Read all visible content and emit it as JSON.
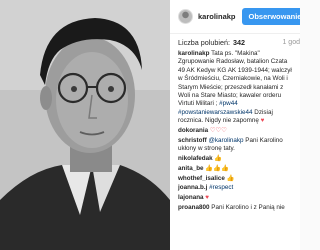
{
  "post": {
    "username": "karolinakp",
    "follow_label": "Obserwowanie",
    "likes_label": "Liczba polubień:",
    "likes_count": "342",
    "time_ago": "1 god"
  },
  "caption": {
    "username": "karolinakp",
    "text1": "Tata ps. \"Makina\" Zgrupowanie Radosław, batalion Czata 49 AK Kedyw KG AK 1939-1944; walczył w Śródmieściu, Czerniakowie, na Woli i Starym Mieście; przeszedł kanałami z Woli na Stare Miasto; kawaler orderu Virtuti Militari ; ",
    "tag1": "#pw44",
    "tag2": "#powstaniewarszawskie44",
    "text2": " Dzisiaj rocznica. Nigdy nie zapomnę ",
    "heart": "♥"
  },
  "comments": [
    {
      "user": "dokorania",
      "text": "",
      "extra": "♡♡♡"
    },
    {
      "user": "schristoff",
      "text": "",
      "mention": "@karolinakp",
      "text2": " Pani Karolino ukłony w stronę taty."
    },
    {
      "user": "nikolafedak",
      "text": "",
      "extra": "👍"
    },
    {
      "user": "anita_be",
      "text": "",
      "extra": "👍👍👍"
    },
    {
      "user": "whothef_isalice",
      "text": "",
      "extra": "👍"
    },
    {
      "user": "joanna.b.j",
      "text": "",
      "tag": "#respect"
    },
    {
      "user": "lajonana",
      "text": "",
      "extra": "♥"
    },
    {
      "user": "proana800",
      "text": " Pani Karolino i z Panią nie"
    }
  ]
}
